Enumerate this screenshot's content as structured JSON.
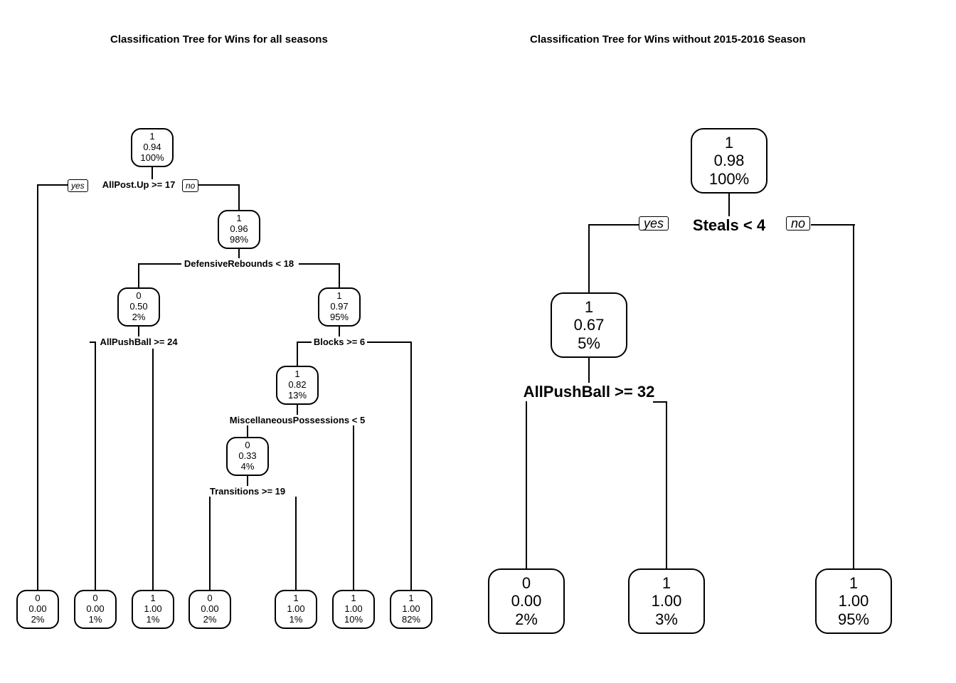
{
  "left": {
    "title": "Classification Tree for Wins for all seasons",
    "splits": {
      "s1": {
        "label": "AllPost.Up >= 17",
        "yes": "yes",
        "no": "no"
      },
      "s2": {
        "label": "DefensiveRebounds < 18"
      },
      "s3": {
        "label": "AllPushBall >= 24"
      },
      "s4": {
        "label": "Blocks >= 6"
      },
      "s5": {
        "label": "MiscellaneousPossessions < 5"
      },
      "s6": {
        "label": "Transitions >= 19"
      }
    },
    "nodes": {
      "root": {
        "class": "1",
        "prob": "0.94",
        "pct": "100%"
      },
      "n_no": {
        "class": "1",
        "prob": "0.96",
        "pct": "98%"
      },
      "n_dr_y": {
        "class": "0",
        "prob": "0.50",
        "pct": "2%"
      },
      "n_dr_n": {
        "class": "1",
        "prob": "0.97",
        "pct": "95%"
      },
      "n_bl_y": {
        "class": "1",
        "prob": "0.82",
        "pct": "13%"
      },
      "n_mp_y": {
        "class": "0",
        "prob": "0.33",
        "pct": "4%"
      },
      "leaf1": {
        "class": "0",
        "prob": "0.00",
        "pct": "2%"
      },
      "leaf2": {
        "class": "0",
        "prob": "0.00",
        "pct": "1%"
      },
      "leaf3": {
        "class": "1",
        "prob": "1.00",
        "pct": "1%"
      },
      "leaf4": {
        "class": "0",
        "prob": "0.00",
        "pct": "2%"
      },
      "leaf5": {
        "class": "1",
        "prob": "1.00",
        "pct": "1%"
      },
      "leaf6": {
        "class": "1",
        "prob": "1.00",
        "pct": "10%"
      },
      "leaf7": {
        "class": "1",
        "prob": "1.00",
        "pct": "82%"
      }
    }
  },
  "right": {
    "title": "Classification Tree for Wins without 2015-2016 Season",
    "splits": {
      "s1": {
        "label": "Steals < 4",
        "yes": "yes",
        "no": "no"
      },
      "s2": {
        "label": "AllPushBall >= 32"
      }
    },
    "nodes": {
      "root": {
        "class": "1",
        "prob": "0.98",
        "pct": "100%"
      },
      "n_y": {
        "class": "1",
        "prob": "0.67",
        "pct": "5%"
      },
      "leaf1": {
        "class": "0",
        "prob": "0.00",
        "pct": "2%"
      },
      "leaf2": {
        "class": "1",
        "prob": "1.00",
        "pct": "3%"
      },
      "leaf3": {
        "class": "1",
        "prob": "1.00",
        "pct": "95%"
      }
    }
  }
}
